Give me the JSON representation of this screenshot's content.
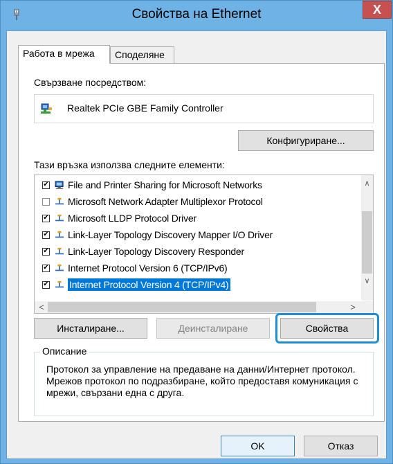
{
  "window": {
    "title": "Свойства на Ethernet",
    "close_label": "X"
  },
  "tabs": [
    {
      "label": "Работа в мрежа",
      "active": true
    },
    {
      "label": "Споделяне",
      "active": false
    }
  ],
  "connect_using": {
    "label": "Свързване посредством:",
    "adapter_name": "Realtek PCIe GBE Family Controller",
    "configure_button": "Конфигуриране..."
  },
  "components": {
    "label": "Тази връзка използва следните елементи:",
    "items": [
      {
        "label": "File and Printer Sharing for Microsoft Networks",
        "checked": true,
        "icon": "computer-icon"
      },
      {
        "label": "Microsoft Network Adapter Multiplexor Protocol",
        "checked": false,
        "icon": "protocol-icon"
      },
      {
        "label": "Microsoft LLDP Protocol Driver",
        "checked": true,
        "icon": "protocol-icon"
      },
      {
        "label": "Link-Layer Topology Discovery Mapper I/O Driver",
        "checked": true,
        "icon": "protocol-icon"
      },
      {
        "label": "Link-Layer Topology Discovery Responder",
        "checked": true,
        "icon": "protocol-icon"
      },
      {
        "label": "Internet Protocol Version 6 (TCP/IPv6)",
        "checked": true,
        "icon": "protocol-icon"
      },
      {
        "label": "Internet Protocol Version 4 (TCP/IPv4)",
        "checked": true,
        "icon": "protocol-icon",
        "selected": true
      }
    ],
    "check_glyph": "✔"
  },
  "buttons": {
    "install": "Инсталиране...",
    "uninstall": "Деинсталиране",
    "properties": "Свойства",
    "ok": "OK",
    "cancel": "Отказ"
  },
  "description": {
    "title": "Описание",
    "text": "Протокол за управление на предаване на данни/Интернет протокол. Мрежов протокол по подразбиране, който предоставя комуникация с мрежи, свързани една с друга."
  },
  "colors": {
    "selection": "#0078d7",
    "highlight_outline": "#1e8fd6",
    "close_button": "#c75050"
  }
}
